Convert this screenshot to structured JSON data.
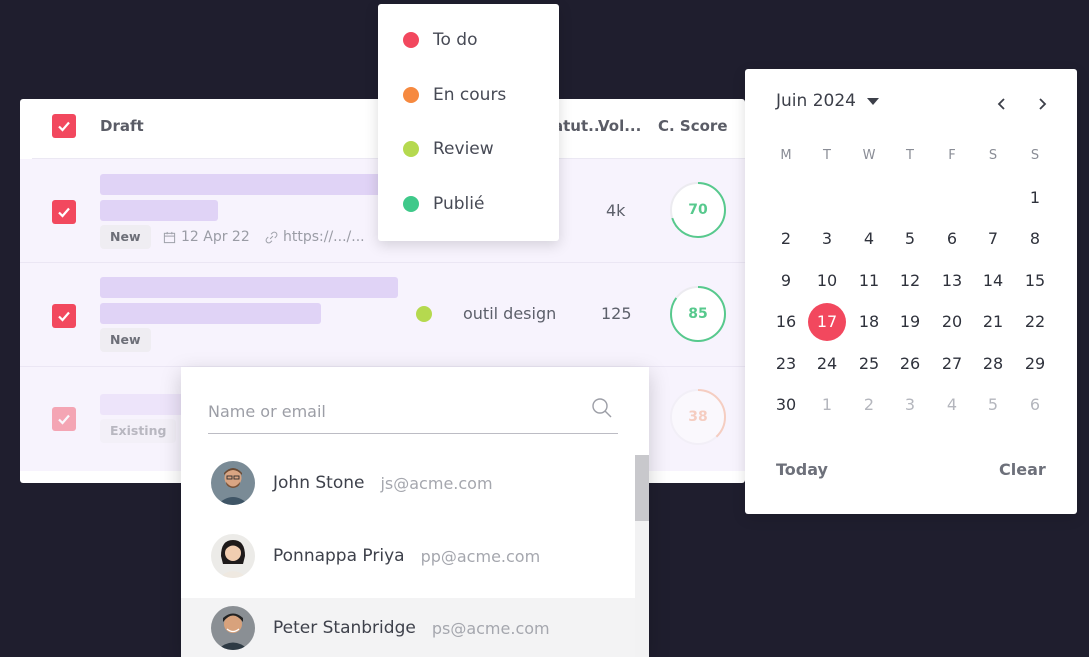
{
  "table": {
    "headers": {
      "draft": "Draft",
      "status": "Statut...",
      "volume": "Vol...",
      "score": "C. Score"
    },
    "rows": [
      {
        "tag": "New",
        "date": "12 Apr 22",
        "url": "https://.../...",
        "status_label": "",
        "volume": "4k",
        "score": "70",
        "score_percent": 70,
        "score_color": "#57c98d"
      },
      {
        "tag": "New",
        "status_label": "outil design",
        "status_color": "#b5d94f",
        "volume": "125",
        "score": "85",
        "score_percent": 85,
        "score_color": "#57c98d"
      },
      {
        "tag": "Existing",
        "score": "38",
        "score_percent": 38,
        "score_color": "#f3a17a"
      }
    ]
  },
  "status_menu": {
    "items": [
      {
        "label": "To do",
        "color": "#f2485e"
      },
      {
        "label": "En cours",
        "color": "#f6893f"
      },
      {
        "label": "Review",
        "color": "#b5d94f"
      },
      {
        "label": "Publié",
        "color": "#3fc98a"
      }
    ]
  },
  "people": {
    "search_placeholder": "Name or email",
    "list": [
      {
        "name": "John Stone",
        "email": "js@acme.com"
      },
      {
        "name": "Ponnappa Priya",
        "email": "pp@acme.com"
      },
      {
        "name": "Peter Stanbridge",
        "email": "ps@acme.com"
      }
    ]
  },
  "calendar": {
    "month_label": "Juin 2024",
    "weekdays": [
      "M",
      "T",
      "W",
      "T",
      "F",
      "S",
      "S"
    ],
    "selected_day": "17",
    "today_label": "Today",
    "clear_label": "Clear",
    "accent": "#f2485e"
  }
}
